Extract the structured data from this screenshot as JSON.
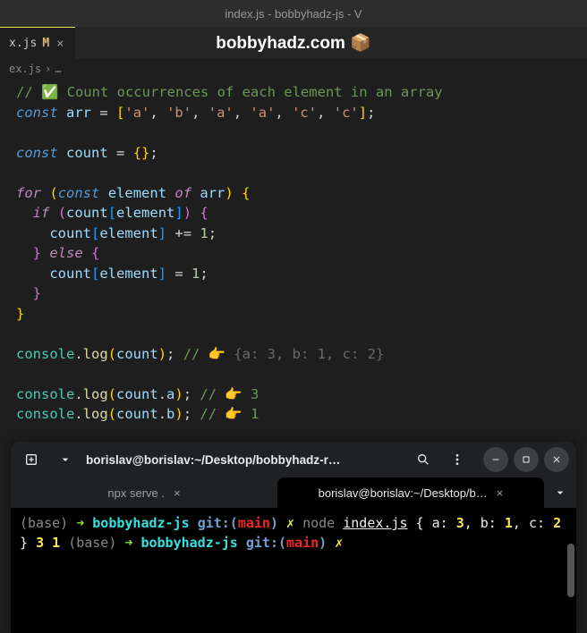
{
  "window": {
    "title": "index.js - bobbyhadz-js - V"
  },
  "tab": {
    "filename": "x.js",
    "modified_marker": "M"
  },
  "page_header": "bobbyhadz.com 📦",
  "breadcrumb": {
    "file": "ex.js",
    "sep": "›",
    "rest": "…"
  },
  "code": {
    "l1_comment": "// ✅ Count occurrences of each element in an array",
    "l2_const": "const",
    "l2_arr": "arr",
    "l2_vals": [
      "'a'",
      "'b'",
      "'a'",
      "'a'",
      "'c'",
      "'c'"
    ],
    "l4_count": "count",
    "l6_for": "for",
    "l6_const": "const",
    "l6_element": "element",
    "l6_of": "of",
    "l7_if": "if",
    "l8_plus": "+=",
    "l8_one": "1",
    "l9_else": "else",
    "l10_eq": "=",
    "l10_one": "1",
    "console": "console",
    "log": "log",
    "cmt_result": "{a: 3, b: 1, c: 2}",
    "cmt_a": "3",
    "cmt_b": "1",
    "a": "a",
    "b": "b"
  },
  "terminal": {
    "titlebar_title": "borislav@borislav:~/Desktop/bobbyhadz-r…",
    "tabs": [
      {
        "label": "npx serve ."
      },
      {
        "label": "borislav@borislav:~/Desktop/b…"
      }
    ],
    "prompt": {
      "base": "(base)",
      "arrow": "➜",
      "dir": "bobbyhadz-js",
      "git_label": "git:(",
      "branch": "main",
      "git_close": ")",
      "dirty": "✗"
    },
    "cmd1": {
      "node": "node",
      "file": "index.js"
    },
    "output": {
      "obj": "{ a: 3, b: 1, c: 2 }",
      "l2": "3",
      "l3": "1"
    }
  }
}
